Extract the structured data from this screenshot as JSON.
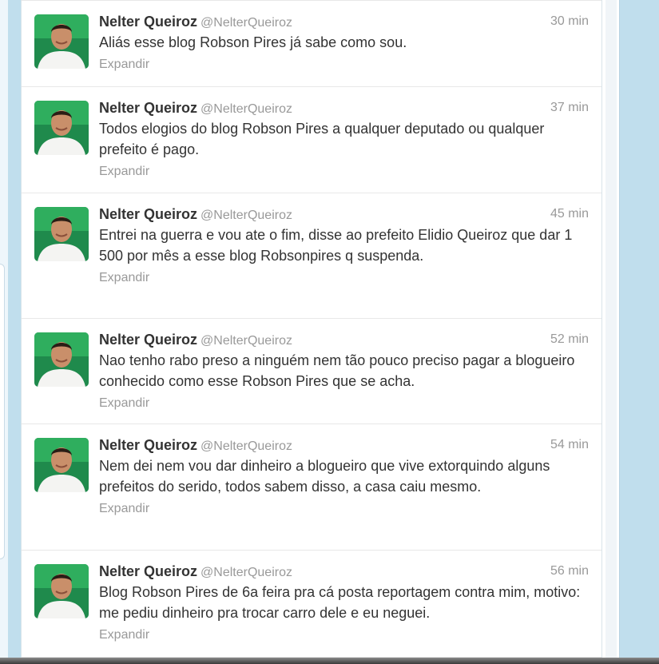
{
  "tweets": [
    {
      "name": "Nelter Queiroz",
      "handle": "@NelterQueiroz",
      "time": "30 min",
      "text": "Aliás esse blog Robson Pires já sabe como sou.",
      "expand": "Expandir"
    },
    {
      "name": "Nelter Queiroz",
      "handle": "@NelterQueiroz",
      "time": "37 min",
      "text": "Todos elogios do blog Robson Pires a qualquer deputado ou qualquer prefeito é pago.",
      "expand": "Expandir"
    },
    {
      "name": "Nelter Queiroz",
      "handle": "@NelterQueiroz",
      "time": "45 min",
      "text": "Entrei na guerra e vou ate o fim, disse ao prefeito Elidio Queiroz que dar 1 500 por mês a esse blog Robsonpires q suspenda.",
      "expand": "Expandir"
    },
    {
      "name": "Nelter Queiroz",
      "handle": "@NelterQueiroz",
      "time": "52 min",
      "text": "Nao tenho rabo preso a ninguém nem tão pouco preciso pagar a blogueiro conhecido como esse Robson Pires que se acha.",
      "expand": "Expandir"
    },
    {
      "name": "Nelter Queiroz",
      "handle": "@NelterQueiroz",
      "time": "54 min",
      "text": "Nem dei nem vou dar dinheiro a blogueiro que vive extorquindo alguns prefeitos do serido, todos sabem disso, a casa caiu mesmo.",
      "expand": "Expandir"
    },
    {
      "name": "Nelter Queiroz",
      "handle": "@NelterQueiroz",
      "time": "56 min",
      "text": "Blog Robson Pires de 6a feira pra cá posta reportagem contra mim, motivo: me pediu dinheiro pra trocar carro dele e eu neguei.",
      "expand": "Expandir"
    }
  ],
  "colors": {
    "background": "#c0deed",
    "name": "#333333",
    "meta": "#999999",
    "avatar_bg": "#1f8a4c"
  },
  "icons": {
    "avatar": "profile-photo-icon"
  }
}
